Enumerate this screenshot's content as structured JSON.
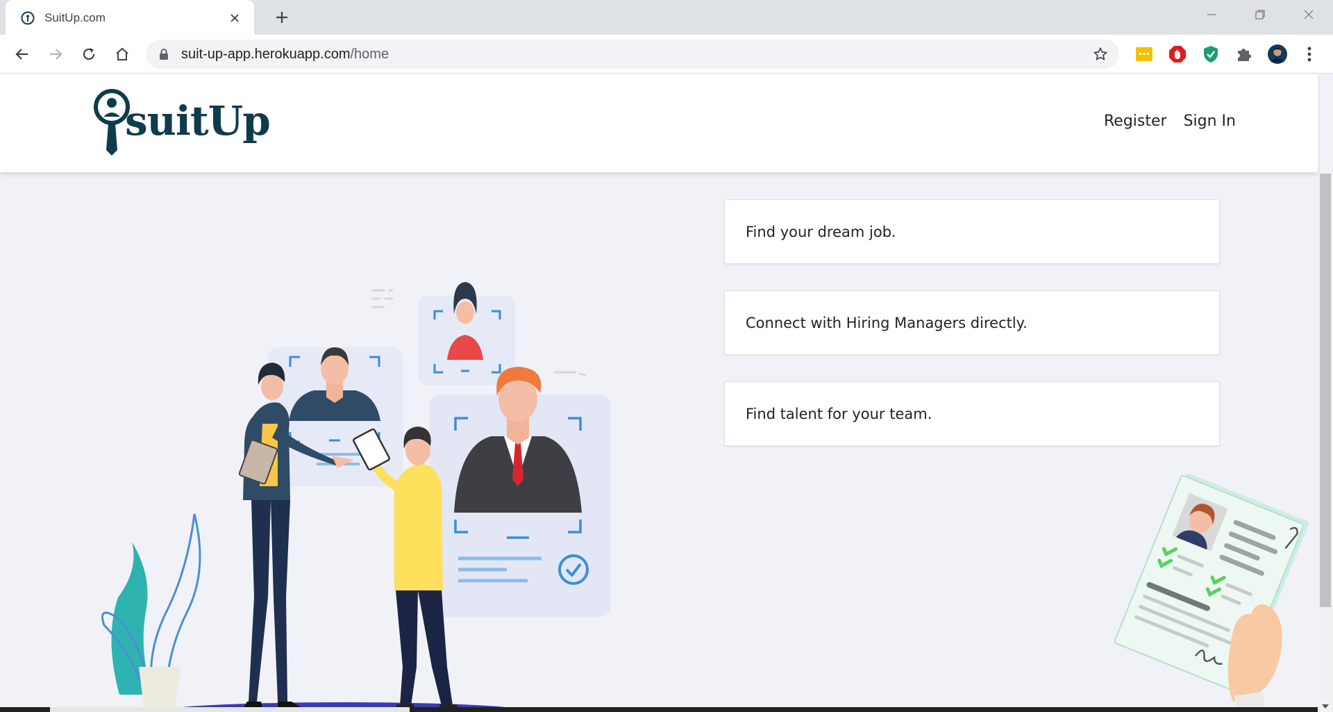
{
  "browser": {
    "tab_title": "SuitUp.com",
    "url_host": "suit-up-app.herokuapp.com",
    "url_path": "/home"
  },
  "site": {
    "logo_text": "suitUp",
    "nav": {
      "register": "Register",
      "sign_in": "Sign In"
    },
    "features": [
      "Find your dream job.",
      "Connect with Hiring Managers directly.",
      "Find talent for your team."
    ]
  },
  "colors": {
    "brand": "#0f3b4c",
    "page_bg": "#f0f2f7",
    "accent_blue": "#3a8fd8",
    "plant_teal": "#2fb3b0",
    "shirt_yellow": "#fde05b"
  },
  "icons": {
    "tab": [
      "favicon-icon",
      "close-icon",
      "plus-icon"
    ],
    "toolbar": [
      "back-arrow-icon",
      "forward-arrow-icon",
      "reload-icon",
      "home-icon",
      "lock-icon",
      "star-icon"
    ],
    "extensions": [
      "keyboard-extension-icon",
      "adblock-icon",
      "shield-extension-icon",
      "puzzle-icon",
      "avatar",
      "menu-dots-icon"
    ]
  }
}
